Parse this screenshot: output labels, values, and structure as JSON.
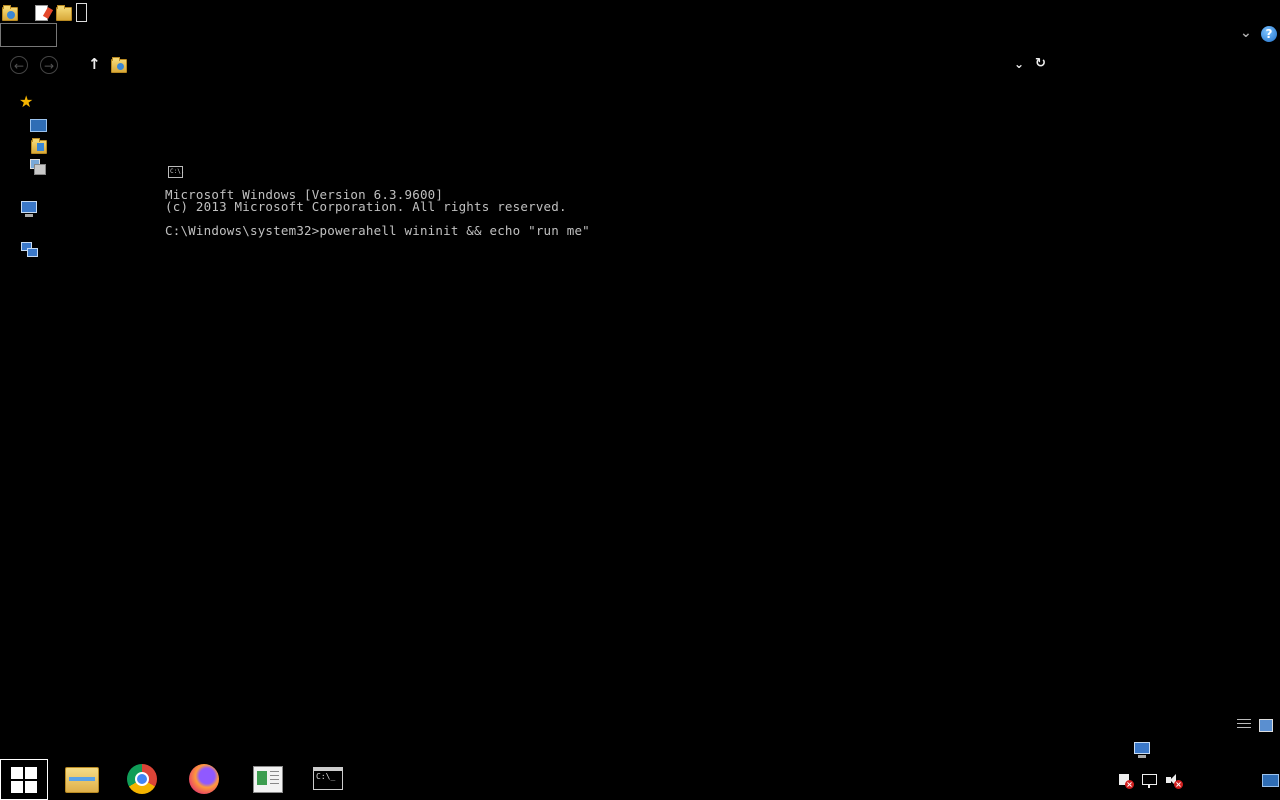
{
  "toolbar": {
    "icons": [
      "properties-icon",
      "new-document-icon",
      "new-folder-icon"
    ]
  },
  "navigation": {
    "back": "back-arrow-icon",
    "forward": "forward-arrow-icon",
    "up": "↑",
    "dropdown": "⌄",
    "refresh": "↻",
    "ribbon_toggle": "⌄",
    "help": "?"
  },
  "sidebar": {
    "items": [
      "favorites-star-icon",
      "desktop-icon",
      "downloads-icon",
      "recent-places-icon",
      "this-pc-icon",
      "network-icon"
    ]
  },
  "console": {
    "icon_text": "C:\\.",
    "lines": [
      "Microsoft Windows [Version 6.3.9600]",
      "(c) 2013 Microsoft Corporation. All rights reserved.",
      "",
      "C:\\Windows\\system32>powerahell wininit && echo \"run me\""
    ]
  },
  "taskbar": {
    "start": "start-button",
    "pinned": [
      "file-explorer",
      "google-chrome",
      "firefox",
      "notepad-document",
      "command-prompt"
    ],
    "cmd_icon_text": "C:\\_"
  },
  "tray": {
    "icons": [
      "action-center-flag-icon",
      "network-icon",
      "volume-muted-icon",
      "show-desktop-icon"
    ]
  },
  "colors": {
    "background": "#000000",
    "console_text": "#c0c0c0",
    "accent": "#1f6fc9"
  }
}
